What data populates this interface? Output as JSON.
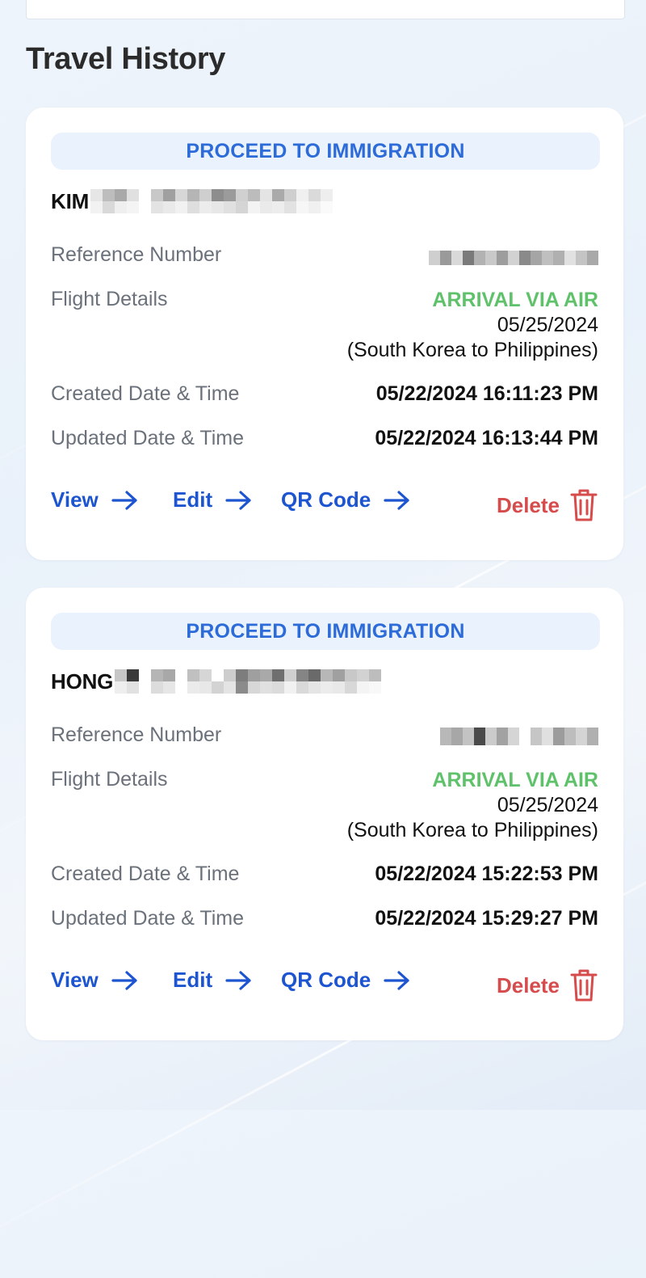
{
  "section_title": "Travel History",
  "actions": {
    "view_label": "View",
    "edit_label": "Edit",
    "qr_label": "QR Code",
    "delete_label": "Delete"
  },
  "labels": {
    "reference": "Reference Number",
    "flight": "Flight Details",
    "created": "Created Date & Time",
    "updated": "Updated Date & Time"
  },
  "cards": [
    {
      "status": "PROCEED TO IMMIGRATION",
      "name_visible": "KIM",
      "flight_mode": "ARRIVAL VIA AIR",
      "flight_date": "05/25/2024",
      "flight_route": "(South Korea to Philippines)",
      "created": "05/22/2024 16:11:23 PM",
      "updated": "05/22/2024 16:13:44 PM"
    },
    {
      "status": "PROCEED TO IMMIGRATION",
      "name_visible": "HONG",
      "flight_mode": "ARRIVAL VIA AIR",
      "flight_date": "05/25/2024",
      "flight_route": "(South Korea to Philippines)",
      "created": "05/22/2024 15:22:53 PM",
      "updated": "05/22/2024 15:29:27 PM"
    }
  ],
  "colors": {
    "accent_blue": "#1c55cf",
    "status_blue": "#2d6cd8",
    "arrival_green": "#5fc26b",
    "delete_red": "#d64b4b"
  }
}
